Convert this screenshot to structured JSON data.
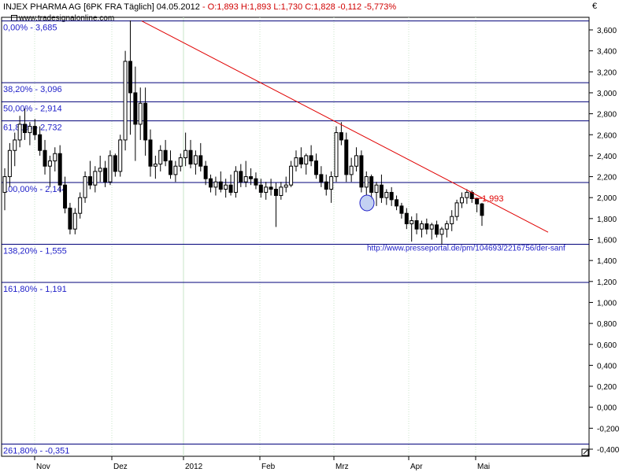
{
  "header": {
    "title": "INJEX PHARMA AG [6PK FRA  Täglich] 04.05.2012",
    "ohlc": "- O:1,893 H:1,893 L:1,730 C:1,828 -0,112 -5,773%"
  },
  "source_label": "www.tradesignalonline.com",
  "currency_label": "€",
  "chart_data": {
    "type": "candlestick",
    "ylim": [
      -0.4,
      3.75
    ],
    "yticks": [
      "3,600",
      "3,400",
      "3,200",
      "3,000",
      "2,800",
      "2,600",
      "2,400",
      "2,200",
      "2,000",
      "1,800",
      "1,600",
      "1,400",
      "1,200",
      "1,000",
      "0,800",
      "0,600",
      "0,400",
      "0,200",
      "0,000",
      "-0,200",
      "-0,400"
    ],
    "xlabels": [
      "Nov",
      "Dez",
      "2012",
      "Feb",
      "Mrz",
      "Apr",
      "Mai"
    ],
    "fib_levels": [
      {
        "label": "0,00% - 3,685",
        "value": 3.685
      },
      {
        "label": "38,20% - 3,096",
        "value": 3.096
      },
      {
        "label": "50,00% - 2,914",
        "value": 2.914
      },
      {
        "label": "61,80% - 2,732",
        "value": 2.732
      },
      {
        "label": "100,00% - 2,144",
        "value": 2.144
      },
      {
        "label": "138,20% - 1,555",
        "value": 1.555
      },
      {
        "label": "161,80% - 1,191",
        "value": 1.191
      },
      {
        "label": "261,80% - -0,351",
        "value": -0.351
      }
    ],
    "last_price_label": "1,993",
    "annotation": "http://www.presseportal.de/pm/104693/2216756/der-sanf",
    "series": [
      {
        "values": [
          [
            2.05,
            2.28,
            1.88,
            2.2
          ],
          [
            2.2,
            2.52,
            2.1,
            2.45
          ],
          [
            2.45,
            2.62,
            2.3,
            2.55
          ],
          [
            2.55,
            2.78,
            2.48,
            2.7
          ],
          [
            2.7,
            2.85,
            2.55,
            2.62
          ],
          [
            2.62,
            2.72,
            2.5,
            2.68
          ],
          [
            2.68,
            2.75,
            2.55,
            2.6
          ],
          [
            2.6,
            2.68,
            2.4,
            2.45
          ],
          [
            2.45,
            2.55,
            2.22,
            2.3
          ],
          [
            2.3,
            2.4,
            2.1,
            2.35
          ],
          [
            2.35,
            2.48,
            2.25,
            2.42
          ],
          [
            2.42,
            2.5,
            2.05,
            2.12
          ],
          [
            2.12,
            2.2,
            1.85,
            1.9
          ],
          [
            1.9,
            1.95,
            1.65,
            1.7
          ],
          [
            1.7,
            1.9,
            1.65,
            1.85
          ],
          [
            1.85,
            2.05,
            1.8,
            2.0
          ],
          [
            2.0,
            2.25,
            1.95,
            2.2
          ],
          [
            2.2,
            2.35,
            2.08,
            2.12
          ],
          [
            2.12,
            2.3,
            2.05,
            2.25
          ],
          [
            2.25,
            2.4,
            2.15,
            2.28
          ],
          [
            2.28,
            2.35,
            2.1,
            2.15
          ],
          [
            2.15,
            2.45,
            2.12,
            2.4
          ],
          [
            2.4,
            2.42,
            2.2,
            2.25
          ],
          [
            2.25,
            2.6,
            2.2,
            2.55
          ],
          [
            2.55,
            3.4,
            2.45,
            3.3
          ],
          [
            3.3,
            3.69,
            2.6,
            3.0
          ],
          [
            3.0,
            3.25,
            2.35,
            2.7
          ],
          [
            2.7,
            3.05,
            2.55,
            2.9
          ],
          [
            2.9,
            3.05,
            2.4,
            2.55
          ],
          [
            2.55,
            2.65,
            2.2,
            2.3
          ],
          [
            2.3,
            2.4,
            2.18,
            2.32
          ],
          [
            2.32,
            2.5,
            2.25,
            2.45
          ],
          [
            2.45,
            2.55,
            2.3,
            2.35
          ],
          [
            2.35,
            2.45,
            2.18,
            2.22
          ],
          [
            2.22,
            2.35,
            2.15,
            2.3
          ],
          [
            2.3,
            2.42,
            2.25,
            2.38
          ],
          [
            2.38,
            2.62,
            2.3,
            2.45
          ],
          [
            2.45,
            2.55,
            2.28,
            2.32
          ],
          [
            2.32,
            2.45,
            2.22,
            2.4
          ],
          [
            2.4,
            2.52,
            2.25,
            2.3
          ],
          [
            2.3,
            2.35,
            2.12,
            2.18
          ],
          [
            2.18,
            2.22,
            2.05,
            2.1
          ],
          [
            2.1,
            2.2,
            2.02,
            2.15
          ],
          [
            2.15,
            2.25,
            2.05,
            2.08
          ],
          [
            2.08,
            2.18,
            2.0,
            2.12
          ],
          [
            2.12,
            2.22,
            2.02,
            2.05
          ],
          [
            2.05,
            2.3,
            2.0,
            2.25
          ],
          [
            2.25,
            2.32,
            2.1,
            2.15
          ],
          [
            2.15,
            2.35,
            2.1,
            2.2
          ],
          [
            2.2,
            2.28,
            2.12,
            2.18
          ],
          [
            2.18,
            2.24,
            2.08,
            2.12
          ],
          [
            2.12,
            2.18,
            2.0,
            2.05
          ],
          [
            2.05,
            2.15,
            1.98,
            2.1
          ],
          [
            2.1,
            2.18,
            2.02,
            2.08
          ],
          [
            2.08,
            2.14,
            1.72,
            2.02
          ],
          [
            2.02,
            2.15,
            1.98,
            2.1
          ],
          [
            2.1,
            2.2,
            2.05,
            2.12
          ],
          [
            2.12,
            2.35,
            2.1,
            2.3
          ],
          [
            2.3,
            2.45,
            2.25,
            2.38
          ],
          [
            2.38,
            2.48,
            2.28,
            2.32
          ],
          [
            2.32,
            2.42,
            2.22,
            2.4
          ],
          [
            2.4,
            2.5,
            2.3,
            2.35
          ],
          [
            2.35,
            2.42,
            2.18,
            2.22
          ],
          [
            2.22,
            2.3,
            2.1,
            2.15
          ],
          [
            2.15,
            2.22,
            2.02,
            2.08
          ],
          [
            2.08,
            2.25,
            1.95,
            2.2
          ],
          [
            2.2,
            2.68,
            2.15,
            2.62
          ],
          [
            2.62,
            2.72,
            2.5,
            2.55
          ],
          [
            2.55,
            2.62,
            2.15,
            2.22
          ],
          [
            2.22,
            2.38,
            2.15,
            2.3
          ],
          [
            2.3,
            2.48,
            2.25,
            2.4
          ],
          [
            2.4,
            2.45,
            2.05,
            2.1
          ],
          [
            2.1,
            2.25,
            2.02,
            2.2
          ],
          [
            2.2,
            2.22,
            1.98,
            2.05
          ],
          [
            2.05,
            2.15,
            1.92,
            2.12
          ],
          [
            2.12,
            2.22,
            1.95,
            2.0
          ],
          [
            2.0,
            2.08,
            1.93,
            2.05
          ],
          [
            2.05,
            2.1,
            1.92,
            1.98
          ],
          [
            1.98,
            2.02,
            1.88,
            1.92
          ],
          [
            1.92,
            1.95,
            1.8,
            1.85
          ],
          [
            1.85,
            1.9,
            1.7,
            1.75
          ],
          [
            1.75,
            1.82,
            1.58,
            1.78
          ],
          [
            1.78,
            1.85,
            1.65,
            1.7
          ],
          [
            1.7,
            1.78,
            1.62,
            1.75
          ],
          [
            1.75,
            1.8,
            1.65,
            1.7
          ],
          [
            1.7,
            1.76,
            1.6,
            1.74
          ],
          [
            1.74,
            1.78,
            1.62,
            1.65
          ],
          [
            1.65,
            1.72,
            1.55,
            1.7
          ],
          [
            1.7,
            1.78,
            1.62,
            1.75
          ],
          [
            1.75,
            1.88,
            1.68,
            1.82
          ],
          [
            1.82,
            1.98,
            1.78,
            1.95
          ],
          [
            1.95,
            2.05,
            1.9,
            2.0
          ],
          [
            2.0,
            2.08,
            1.94,
            2.05
          ],
          [
            2.05,
            2.07,
            1.95,
            1.99
          ],
          [
            1.99,
            2.0,
            1.86,
            1.94
          ],
          [
            1.94,
            1.95,
            1.73,
            1.83
          ]
        ]
      }
    ]
  }
}
